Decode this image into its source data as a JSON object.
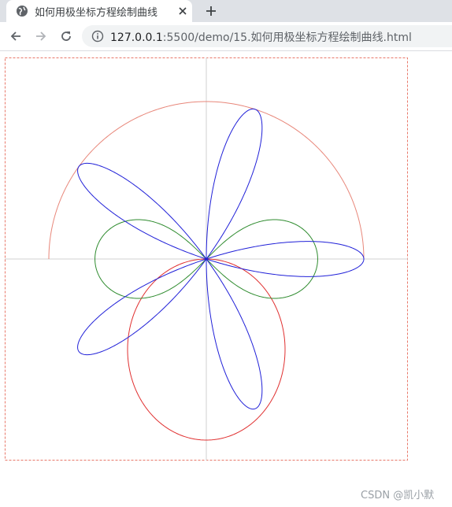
{
  "browser": {
    "tab": {
      "favicon": "globe-icon",
      "title": "如何用极坐标方程绘制曲线",
      "close_icon": "close-icon"
    },
    "new_tab_icon": "plus-icon",
    "nav": {
      "back_icon": "arrow-left-icon",
      "forward_icon": "arrow-right-icon",
      "reload_icon": "reload-icon"
    },
    "address": {
      "info_icon": "info-icon",
      "host": "127.0.0.1",
      "rest": ":5500/demo/15.如何用极坐标方程绘制曲线.html"
    }
  },
  "canvas": {
    "frame_color": "#e8786a",
    "axis_color": "#d0d0d0",
    "curves": [
      {
        "name": "semicircle",
        "color": "#e8877a",
        "equation": "r = 200, theta from 0 to pi (upper half)"
      },
      {
        "name": "circle",
        "color": "#e03030",
        "equation": "r = 200 sin(theta), y axis downward (circle centered below origin, diameter 200)"
      },
      {
        "name": "lemniscate",
        "color": "#2e8b2e",
        "equation": "r^2 = 20000 cos(2 theta)"
      },
      {
        "name": "rose",
        "color": "#2020d8",
        "equation": "r = 200 cos(5 theta)"
      }
    ]
  },
  "watermark": "CSDN @凯小默"
}
